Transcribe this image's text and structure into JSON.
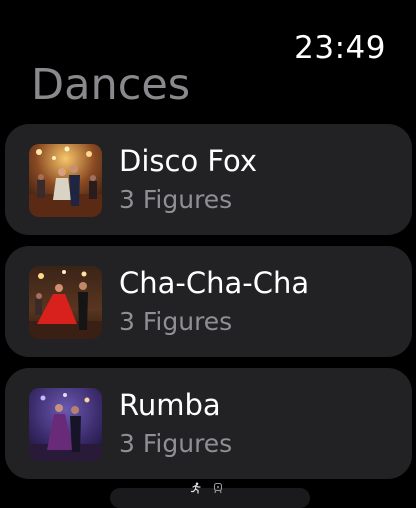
{
  "status": {
    "time": "23:49",
    "icons": [
      "workout-running-icon",
      "remote-icon"
    ]
  },
  "header": {
    "title": "Dances"
  },
  "dances": [
    {
      "name": "Disco Fox",
      "subtitle": "3 Figures",
      "image": "disco-fox-photo"
    },
    {
      "name": "Cha-Cha-Cha",
      "subtitle": "3 Figures",
      "image": "cha-cha-cha-photo"
    },
    {
      "name": "Rumba",
      "subtitle": "3 Figures",
      "image": "rumba-photo"
    }
  ],
  "colors": {
    "background": "#000000",
    "card": "#222224",
    "title": "#8a8a8e",
    "subtitle": "#8f8f94"
  }
}
